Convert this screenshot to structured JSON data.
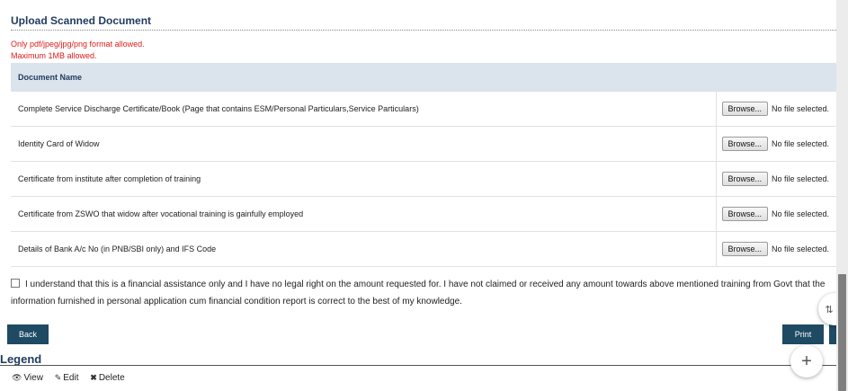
{
  "section": {
    "title": "Upload Scanned Document",
    "note_format": "Only pdf/jpeg/jpg/png format allowed.",
    "note_size": "Maximum 1MB allowed."
  },
  "table": {
    "header": "Document Name",
    "browse_label": "Browse...",
    "no_file_label": "No file selected.",
    "rows": [
      "Complete Service Discharge Certificate/Book (Page that contains ESM/Personal Particulars,Service Particulars)",
      "Identity Card of Widow",
      "Certificate from institute after completion of training",
      "Certificate from ZSWO that widow after vocational training is gainfully employed",
      "Details of Bank A/c No (in PNB/SBI only) and IFS Code"
    ]
  },
  "consent": {
    "text": "I understand that this is a financial assistance only and I have no legal right on the amount requested for. I have not claimed or received any amount towards above mentioned training from Govt that the information furnished in personal application cum financial condition report is correct to the best of my knowledge."
  },
  "actions": {
    "back": "Back",
    "print": "Print"
  },
  "legend": {
    "title": "Legend",
    "view": "View",
    "edit": "Edit",
    "delete": "Delete"
  },
  "icons": {
    "view": "eye-icon",
    "edit": "edit-icon",
    "delete": "delete-icon",
    "fab": "plus-icon"
  },
  "colors": {
    "header_bg": "#dbe4ec",
    "button": "#1e4a63",
    "note": "#e01b1b"
  }
}
